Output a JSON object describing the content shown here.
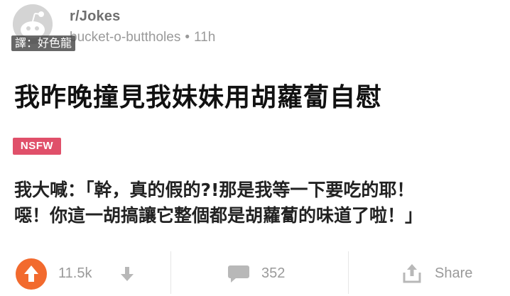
{
  "header": {
    "subreddit": "r/Jokes",
    "author": "bucket-o-buttholes",
    "separator": "•",
    "age": "11h",
    "watermark": "譯：好色龍"
  },
  "post": {
    "title": "我昨晚撞見我妹妹用胡蘿蔔自慰",
    "nsfw_label": "NSFW",
    "body_lines": [
      "我大喊：「幹，真的假的?!那是我等一下要吃的耶！",
      "噁！你這一胡搞讓它整個都是胡蘿蔔的味道了啦！」"
    ]
  },
  "actions": {
    "score": "11.5k",
    "comments": "352",
    "share_label": "Share"
  },
  "icons": {
    "avatar": "reddit-snoo-avatar-icon",
    "upvote": "arrow-up-icon",
    "downvote": "arrow-down-icon",
    "comment": "speech-bubble-icon",
    "share": "share-icon"
  },
  "colors": {
    "upvote": "#f26a2e",
    "nsfw": "#e0506a",
    "muted": "#9a9a9a"
  }
}
